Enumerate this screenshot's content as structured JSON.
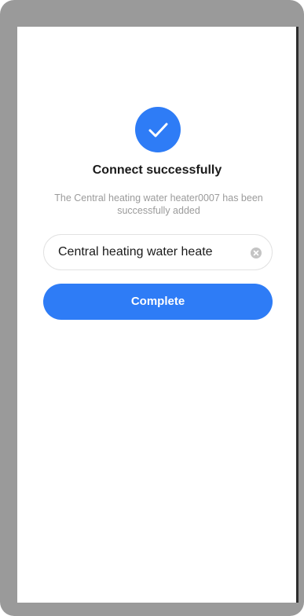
{
  "dialog": {
    "title": "Connect successfully",
    "message": "The Central heating water heater0007 has been successfully added",
    "device_name_value": "Central heating water heate",
    "complete_label": "Complete"
  },
  "icons": {
    "success": "check-circle-icon",
    "clear": "clear-input-icon"
  },
  "colors": {
    "accent": "#2e7cf6",
    "frame": "#9a9a9a",
    "muted_text": "#9b9b9b"
  }
}
